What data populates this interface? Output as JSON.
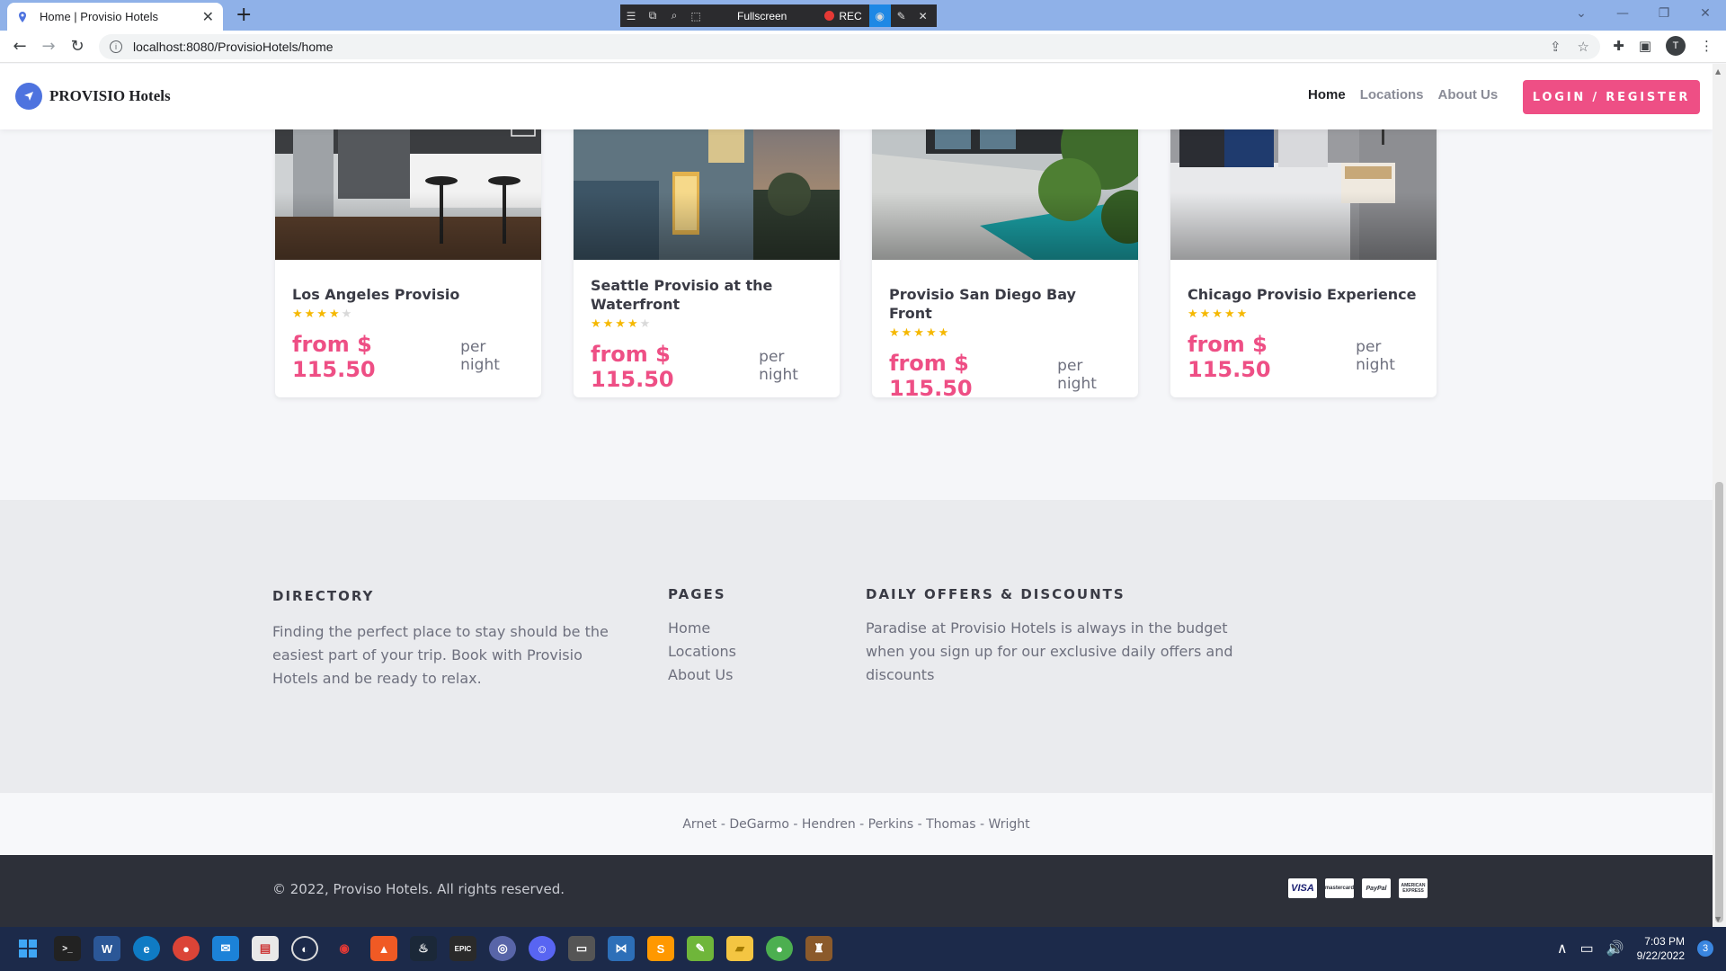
{
  "browser": {
    "tab_title": "Home | Provisio Hotels",
    "new_tab": "+",
    "url": "localhost:8080/ProvisioHotels/home",
    "recorder": {
      "fullscreen_label": "Fullscreen",
      "rec_label": "REC"
    },
    "profile_initial": "T"
  },
  "site": {
    "brand": "PROVISIO Hotels",
    "nav": {
      "home": "Home",
      "locations": "Locations",
      "about": "About Us"
    },
    "login_button": "LOGIN / REGISTER",
    "accent_color": "#ee4f85"
  },
  "hotels": [
    {
      "name": "Los Angeles Provisio",
      "rating": 4,
      "price": "from $ 115.50",
      "unit": "per night"
    },
    {
      "name": "Seattle Provisio at the Waterfront",
      "rating": 4,
      "price": "from $ 115.50",
      "unit": "per night"
    },
    {
      "name": "Provisio San Diego Bay Front",
      "rating": 5,
      "price": "from $ 115.50",
      "unit": "per night"
    },
    {
      "name": "Chicago Provisio Experience",
      "rating": 5,
      "price": "from $ 115.50",
      "unit": "per night"
    }
  ],
  "footer": {
    "directory": {
      "heading": "DIRECTORY",
      "text": "Finding the perfect place to stay should be the easiest part of your trip. Book with Provisio Hotels and be ready to relax."
    },
    "pages": {
      "heading": "PAGES",
      "links": [
        "Home",
        "Locations",
        "About Us"
      ]
    },
    "offers": {
      "heading": "DAILY OFFERS & DISCOUNTS",
      "text": "Paradise at Provisio Hotels is always in the budget when you sign up for our exclusive daily offers and discounts"
    },
    "credits": "Arnet - DeGarmo - Hendren - Perkins - Thomas - Wright",
    "copyright": "© 2022, Proviso Hotels. All rights reserved.",
    "payment_icons": [
      "VISA",
      "mastercard",
      "PayPal",
      "AMERICAN EXPRESS"
    ]
  },
  "taskbar": {
    "time": "7:03 PM",
    "date": "9/22/2022",
    "notifications": "3"
  }
}
